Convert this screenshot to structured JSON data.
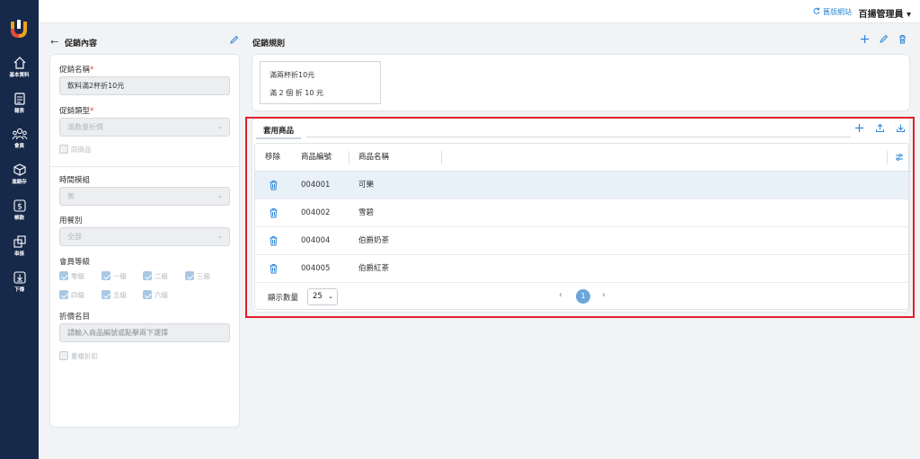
{
  "sidebar": {
    "items": [
      {
        "label": "基本資料",
        "icon": "home-icon"
      },
      {
        "label": "報表",
        "icon": "report-icon"
      },
      {
        "label": "會員",
        "icon": "members-icon"
      },
      {
        "label": "進銷存",
        "icon": "inventory-icon"
      },
      {
        "label": "帳款",
        "icon": "money-icon"
      },
      {
        "label": "串接",
        "icon": "integration-icon"
      },
      {
        "label": "下傳",
        "icon": "download-icon"
      }
    ]
  },
  "topbar": {
    "old_site": "舊版網站",
    "user": "百揚管理員 ▾"
  },
  "left": {
    "title": "促銷內容",
    "name_label": "促銷名稱",
    "name_value": "飲料滿2杯折10元",
    "type_label": "促銷類型",
    "type_value": "滿數量折價",
    "same_product": "同商品",
    "time_label": "時間模組",
    "time_value": "無",
    "meal_label": "用餐別",
    "meal_value": "全部",
    "level_label": "會員等級",
    "levels": [
      "零級",
      "一級",
      "二級",
      "三級",
      "四級",
      "五級",
      "六級"
    ],
    "discount_label": "折價名目",
    "discount_placeholder": "請輸入商品編號或點擊兩下選擇",
    "repeat_discount": "重複折扣"
  },
  "rules": {
    "title": "促銷規則",
    "lines": [
      "滿兩杯折10元",
      "滿 2 個 折 10 元"
    ]
  },
  "products": {
    "tab": "套用商品",
    "columns": [
      "移除",
      "商品編號",
      "商品名稱"
    ],
    "rows": [
      {
        "code": "004001",
        "name": "可樂"
      },
      {
        "code": "004002",
        "name": "雪碧"
      },
      {
        "code": "004004",
        "name": "伯爵奶茶"
      },
      {
        "code": "004005",
        "name": "伯爵紅茶"
      }
    ],
    "page_size_label": "顯示數量",
    "page_size": "25",
    "current_page": "1"
  },
  "colors": {
    "sidebar": "#17294a",
    "accent": "#2e86d6",
    "highlight": "#e0202a"
  }
}
